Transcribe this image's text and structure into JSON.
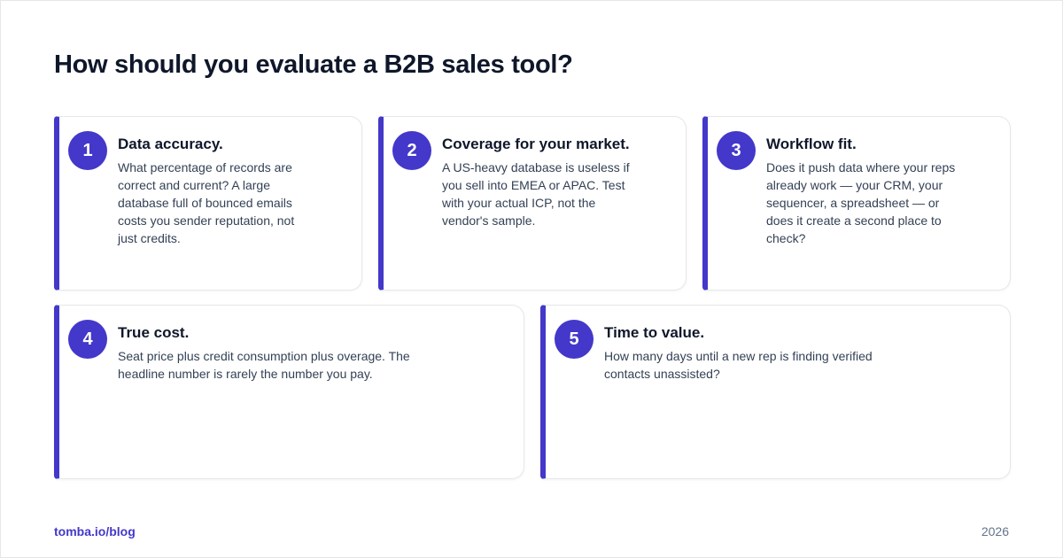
{
  "title": "How should you evaluate a B2B sales tool?",
  "cards": [
    {
      "number": "1",
      "title": "Data accuracy.",
      "description": "What percentage of records are correct and current? A large database full of bounced emails costs you sender reputation, not just credits."
    },
    {
      "number": "2",
      "title": "Coverage for your market.",
      "description": "A US-heavy database is useless if you sell into EMEA or APAC. Test with your actual ICP, not the vendor's sample."
    },
    {
      "number": "3",
      "title": "Workflow fit.",
      "description": "Does it push data where your reps already work — your CRM, your sequencer, a spreadsheet — or does it create a second place to check?"
    },
    {
      "number": "4",
      "title": "True cost.",
      "description": "Seat price plus credit consumption plus overage. The headline number is rarely the number you pay."
    },
    {
      "number": "5",
      "title": "Time to value.",
      "description": "How many days until a new rep is finding verified contacts unassisted?"
    }
  ],
  "footer": {
    "link": "tomba.io/blog",
    "year": "2026"
  },
  "colors": {
    "accent": "#4338ca",
    "title": "#0f172a",
    "body": "#334155",
    "muted": "#64748b"
  }
}
